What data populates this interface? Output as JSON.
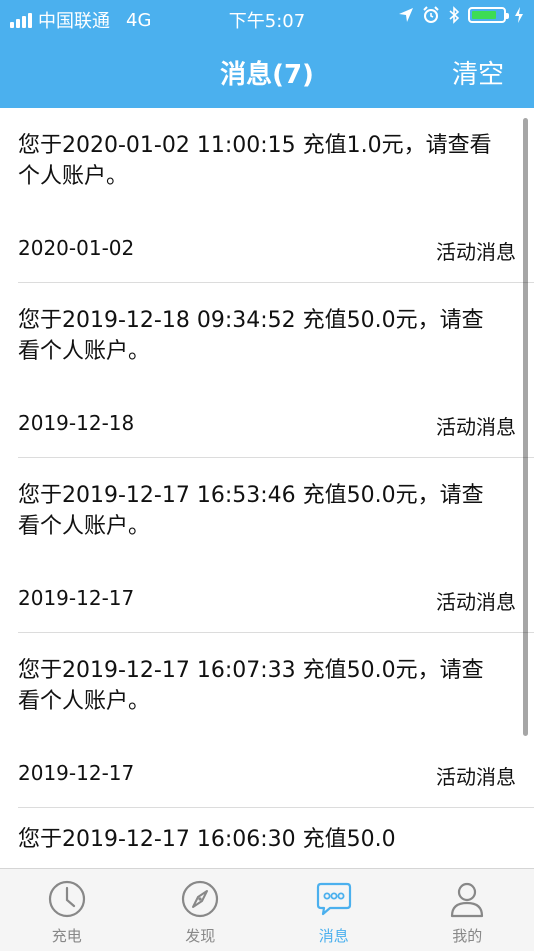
{
  "status_bar": {
    "carrier": "中国联通",
    "network": "4G",
    "time": "下午5:07"
  },
  "nav": {
    "title": "消息(7)",
    "clear_label": "清空"
  },
  "messages": [
    {
      "content": "您于2020-01-02 11:00:15 充值1.0元，请查看个人账户。",
      "date": "2020-01-02",
      "type": "活动消息"
    },
    {
      "content": "您于2019-12-18 09:34:52 充值50.0元，请查看个人账户。",
      "date": "2019-12-18",
      "type": "活动消息"
    },
    {
      "content": "您于2019-12-17 16:53:46 充值50.0元，请查看个人账户。",
      "date": "2019-12-17",
      "type": "活动消息"
    },
    {
      "content": "您于2019-12-17 16:07:33 充值50.0元，请查看个人账户。",
      "date": "2019-12-17",
      "type": "活动消息"
    },
    {
      "content": "您于2019-12-17 16:06:30 充值50.0",
      "date": "",
      "type": ""
    }
  ],
  "tabs": [
    {
      "label": "充电",
      "icon": "clock-icon"
    },
    {
      "label": "发现",
      "icon": "compass-icon"
    },
    {
      "label": "消息",
      "icon": "chat-bubble-icon"
    },
    {
      "label": "我的",
      "icon": "person-icon"
    }
  ],
  "colors": {
    "primary": "#4bb0ee",
    "tab_inactive": "#888888"
  }
}
